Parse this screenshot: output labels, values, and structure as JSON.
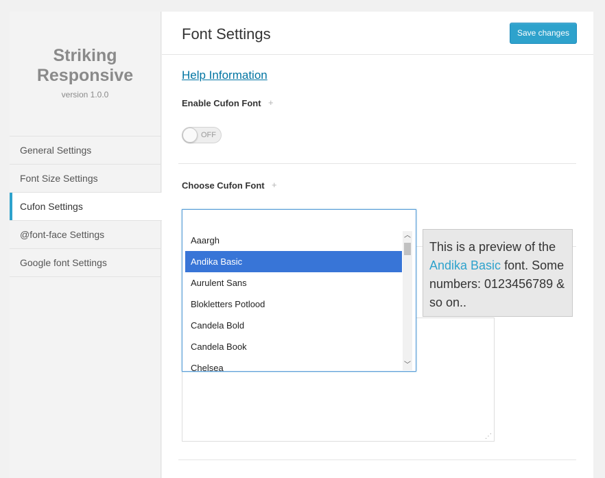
{
  "sidebar": {
    "brand_line1": "Striking",
    "brand_line2": "Responsive",
    "version": "version 1.0.0",
    "items": [
      {
        "label": "General Settings"
      },
      {
        "label": "Font Size Settings"
      },
      {
        "label": "Cufon Settings"
      },
      {
        "label": "@font-face Settings"
      },
      {
        "label": "Google font Settings"
      }
    ],
    "active_index": 2
  },
  "header": {
    "title": "Font Settings",
    "save_label": "Save changes"
  },
  "content": {
    "help_link": "Help Information",
    "enable_label": "Enable Cufon Font",
    "toggle_state": "OFF",
    "choose_label": "Choose Cufon Font",
    "plus_icon": "+"
  },
  "dropdown": {
    "search_value": "",
    "options": [
      "Aaargh",
      "Andika Basic",
      "Aurulent Sans",
      "Blokletters Potlood",
      "Candela Bold",
      "Candela Book",
      "Chelsea"
    ],
    "selected": "Andika Basic"
  },
  "preview": {
    "before": "This is a preview of the ",
    "font_name": "Andika Basic",
    "after": " font. Some numbers: 0123456789 & so on.."
  },
  "colors": {
    "accent": "#2ea2cc",
    "selected_option": "#3875d7",
    "link": "#0074a2"
  }
}
